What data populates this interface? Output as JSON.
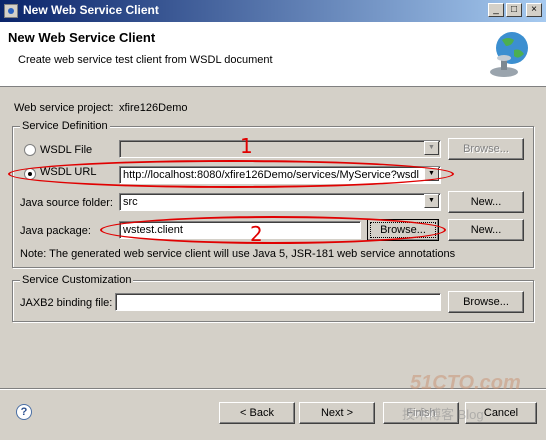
{
  "window": {
    "title": "New Web Service Client",
    "controls": [
      "_",
      "□",
      "×"
    ]
  },
  "banner": {
    "title": "New Web Service Client",
    "description": "Create web service test client from WSDL document"
  },
  "project": {
    "label": "Web service project:",
    "value": "xfire126Demo"
  },
  "service_definition": {
    "title": "Service Definition",
    "wsdl_file": {
      "label": "WSDL File",
      "value": "",
      "browse": "Browse..."
    },
    "wsdl_url": {
      "label": "WSDL URL",
      "value": "http://localhost:8080/xfire126Demo/services/MyService?wsdl"
    },
    "java_source": {
      "label": "Java source folder:",
      "value": "src",
      "new": "New..."
    },
    "java_package": {
      "label": "Java package:",
      "value": "wstest.client",
      "browse": "Browse...",
      "new": "New..."
    },
    "note": "Note: The generated web service client will use Java 5, JSR-181 web service annotations"
  },
  "service_customization": {
    "title": "Service Customization",
    "jaxb": {
      "label": "JAXB2 binding file:",
      "value": "",
      "browse": "Browse..."
    }
  },
  "footer": {
    "back": "< Back",
    "next": "Next >",
    "finish": "Finish",
    "cancel": "Cancel"
  },
  "annotations": {
    "one": "1",
    "two": "2"
  },
  "watermark": {
    "line1": "51CTO.com",
    "line2": "技术博客 Blog"
  }
}
